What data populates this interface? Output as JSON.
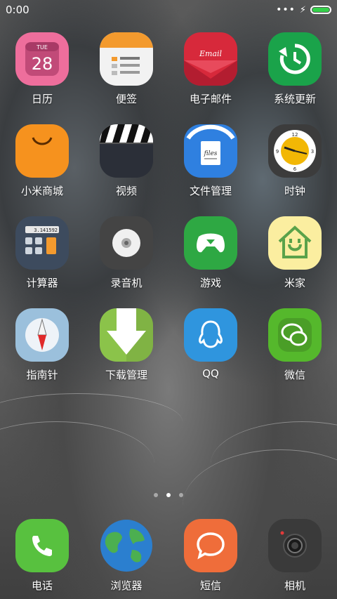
{
  "status": {
    "time": "0:00",
    "overflow": "•••"
  },
  "apps": {
    "calendar": {
      "label": "日历",
      "weekday": "TUE",
      "day": "28"
    },
    "notes": {
      "label": "便签"
    },
    "email": {
      "label": "电子邮件",
      "badge_text": "Email"
    },
    "updater": {
      "label": "系统更新"
    },
    "mall": {
      "label": "小米商城"
    },
    "video": {
      "label": "视频"
    },
    "files": {
      "label": "文件管理",
      "doc_text": "files"
    },
    "clock": {
      "label": "时钟",
      "n12": "12",
      "n3": "3",
      "n6": "6",
      "n9": "9"
    },
    "calculator": {
      "label": "计算器",
      "display": "3.141592"
    },
    "recorder": {
      "label": "录音机"
    },
    "games": {
      "label": "游戏"
    },
    "mihome": {
      "label": "米家"
    },
    "compass": {
      "label": "指南针"
    },
    "downloads": {
      "label": "下载管理"
    },
    "qq": {
      "label": "QQ"
    },
    "wechat": {
      "label": "微信"
    }
  },
  "dock": {
    "phone": {
      "label": "电话"
    },
    "browser": {
      "label": "浏览器"
    },
    "sms": {
      "label": "短信"
    },
    "camera": {
      "label": "相机"
    }
  },
  "pager": {
    "pages": 3,
    "active_index": 1
  },
  "colors": {
    "calendar": "#ee6e9c",
    "notes": "#f2f2f2",
    "email": "#d7293b",
    "updater": "#1aa34a",
    "mall": "#f6921e",
    "video": "#2b2f38",
    "files": "#2f80e0",
    "clock": "#3c3c3c",
    "calculator": "#3d4b5e",
    "recorder": "#444",
    "games": "#2ea843",
    "mihome": "#fbeea0",
    "compass": "#9bc0dc",
    "downloads": "#8bc34a",
    "qq": "#2f95de",
    "wechat": "#55b82c",
    "phone": "#58c13f",
    "browser": "#2b7fcf",
    "sms": "#ef6d3a",
    "camera": "#3a3a3a"
  }
}
